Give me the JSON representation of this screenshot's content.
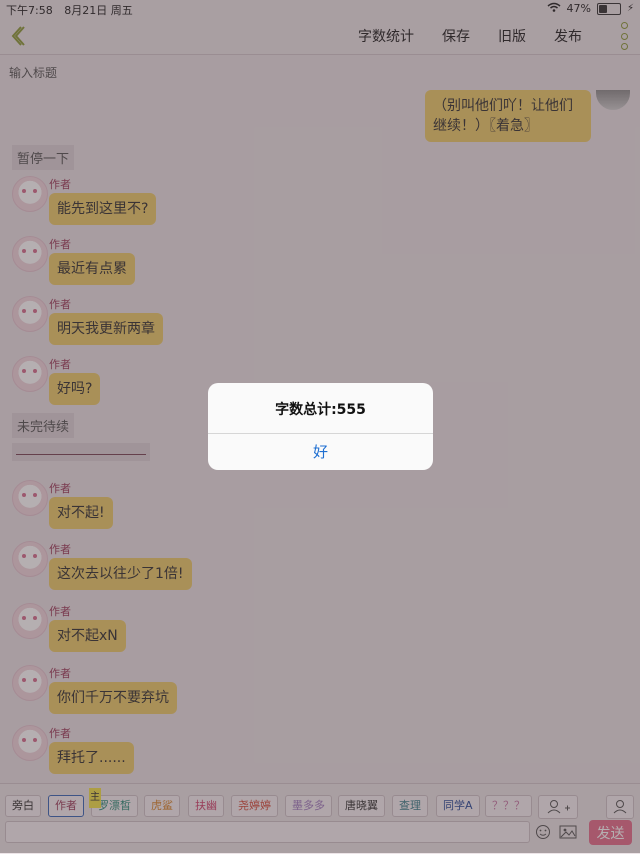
{
  "status": {
    "time": "下午7:58",
    "date": "8月21日 周五",
    "battery": "47%",
    "battery_level": 0.47
  },
  "toolbar": {
    "count_label": "字数统计",
    "save_label": "保存",
    "old_label": "旧版",
    "publish_label": "发布"
  },
  "title_placeholder": "输入标题",
  "right_message": "（别叫他们吖！让他们继续！）〖着急〗",
  "labels": {
    "pause": "暂停一下",
    "unfinished": "未完待续"
  },
  "messages_part1": [
    {
      "name": "作者",
      "text": "能先到这里不?"
    },
    {
      "name": "作者",
      "text": "最近有点累"
    },
    {
      "name": "作者",
      "text": "明天我更新两章"
    },
    {
      "name": "作者",
      "text": "好吗?"
    }
  ],
  "messages_part2": [
    {
      "name": "作者",
      "text": "对不起!"
    },
    {
      "name": "作者",
      "text": "这次去以往少了1倍!"
    },
    {
      "name": "作者",
      "text": "对不起xN"
    },
    {
      "name": "作者",
      "text": "你们千万不要弃坑"
    },
    {
      "name": "作者",
      "text": "拜托了......"
    }
  ],
  "dialog": {
    "title": "字数总计:555",
    "ok": "好"
  },
  "roles": [
    {
      "label": "旁白",
      "color": "#333333"
    },
    {
      "label": "作者",
      "color": "#9c3b5a",
      "active": true
    },
    {
      "label": "罗漂皙",
      "color": "#2f8f7c",
      "badge": "主"
    },
    {
      "label": "虎鲨",
      "color": "#d9882f"
    },
    {
      "label": "扶幽",
      "color": "#d0436e"
    },
    {
      "label": "尧婷婷",
      "color": "#d54a3a"
    },
    {
      "label": "墨多多",
      "color": "#a07cc0"
    },
    {
      "label": "唐晓翼",
      "color": "#333333"
    },
    {
      "label": "查理",
      "color": "#3a7f8a"
    },
    {
      "label": "同学A",
      "color": "#2b4c9a"
    },
    {
      "label": "？？？",
      "color": "#c87aa8"
    }
  ],
  "send_label": "发送"
}
